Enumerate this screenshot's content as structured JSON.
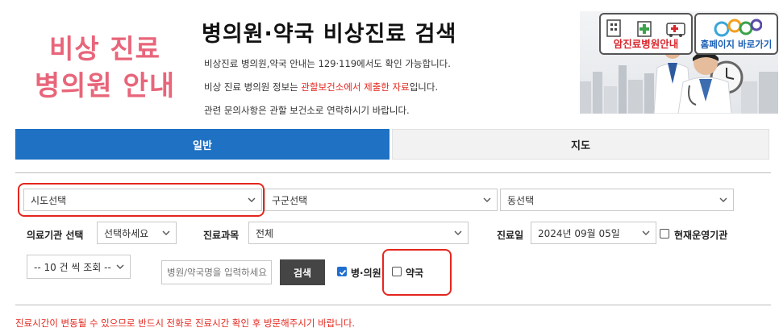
{
  "logo": {
    "line1": "비상 진료",
    "line2": "병의원 안내"
  },
  "header": {
    "title": "병의원·약국 비상진료 검색",
    "desc1": "비상진료 병의원,약국 안내는 129·119에서도 확인 가능합니다.",
    "desc2_prefix": "비상 진료 병의원 정보는 ",
    "desc2_highlight": "관할보건소에서 제출한 자료",
    "desc2_suffix": "입니다.",
    "desc3": "관련 문의사항은 관할 보건소로 연락하시기 바랍니다."
  },
  "banner": {
    "cancer_label": "암진료병원안내",
    "egen_label": "홈페이지 바로가기"
  },
  "tabs": [
    {
      "label": "일반",
      "active": true
    },
    {
      "label": "지도",
      "active": false
    }
  ],
  "filters": {
    "sido": "시도선택",
    "gugun": "구군선택",
    "dong": "동선택",
    "inst_label": "의료기관 선택",
    "inst_value": "선택하세요",
    "dept_label": "진료과목",
    "dept_value": "전체",
    "date_label": "진료일",
    "date_value": "2024년 09월 05일",
    "operating_label": "현재운영기관",
    "operating_checked": false,
    "view_count": "-- 10 건 씩 조회 --",
    "search_placeholder": "병원/약국명을 입력하세요",
    "search_button": "검색",
    "hospital_label": "병·의원",
    "hospital_checked": true,
    "pharmacy_label": "약국",
    "pharmacy_checked": false
  },
  "notice": "진료시간이 변동될 수 있으므로 반드시 전화로 진료시간 확인 후 방문해주시기 바랍니다.",
  "colors": {
    "accent_blue": "#1e71c3",
    "logo_pink": "#e8657a",
    "alert_red": "#e4261d"
  }
}
